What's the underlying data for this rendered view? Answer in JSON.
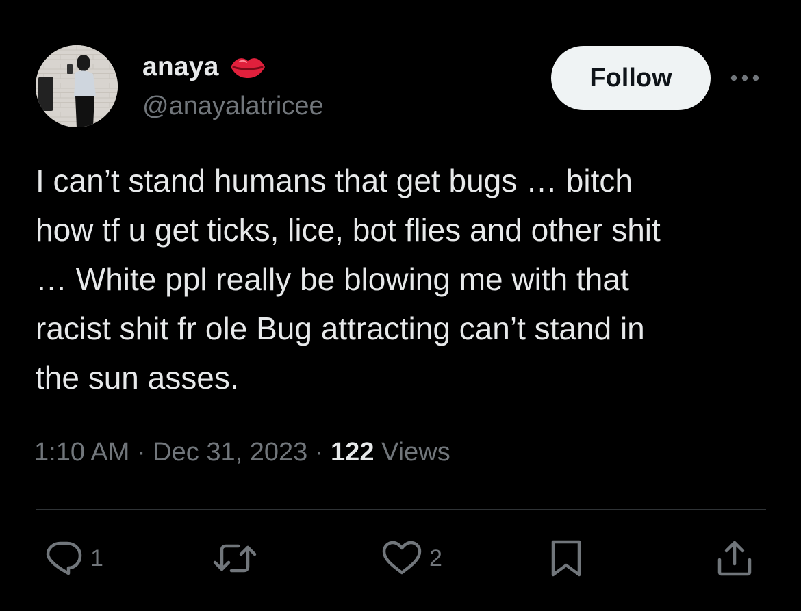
{
  "tweet": {
    "author": {
      "display_name": "anaya",
      "emoji_icon": "kiss-lips-icon",
      "handle": "@anayalatricee",
      "avatar_icon": "profile-photo"
    },
    "follow_label": "Follow",
    "more_icon": "more-dots-icon",
    "text": "I can’t stand humans that get bugs … bitch\nhow tf u get ticks, lice, bot flies and other shit\n… White ppl really be blowing me with that\nracist shit fr ole Bug attracting can’t stand in\nthe sun asses.",
    "time": "1:10 AM",
    "separator": "·",
    "date": "Dec 31, 2023",
    "views_count": "122",
    "views_label": "Views"
  },
  "actions": {
    "reply": {
      "icon": "reply-icon",
      "count": "1"
    },
    "repost": {
      "icon": "repost-icon",
      "count": ""
    },
    "like": {
      "icon": "heart-icon",
      "count": "2"
    },
    "bookmark": {
      "icon": "bookmark-icon"
    },
    "share": {
      "icon": "share-icon"
    }
  },
  "colors": {
    "background": "#000000",
    "primary_text": "#e7e9ea",
    "secondary_text": "#71767b",
    "follow_button_bg": "#eff3f4",
    "divider": "#2f3336",
    "emoji_red": "#e0203c"
  }
}
